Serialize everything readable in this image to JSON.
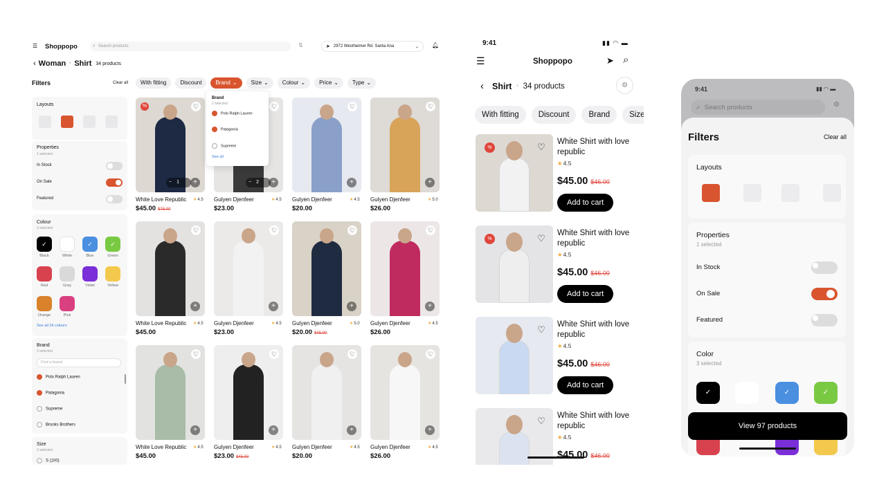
{
  "desktop": {
    "logo": "Shoppopo",
    "search_placeholder": "Search products",
    "address": "2972 Westheimer Rd. Santa Ana",
    "breadcrumb": {
      "level1": "Woman",
      "level2": "Shirt",
      "count": "34 products"
    },
    "filters_title": "Filters",
    "clear_all": "Clear all",
    "chips": [
      "With fitting",
      "Discount",
      "Brand",
      "Size",
      "Colour",
      "Price",
      "Type"
    ],
    "brand_dropdown": {
      "title": "Brand",
      "subtitle": "2 selected",
      "options": [
        "Polo Ralph Lauren",
        "Patagonia",
        "Supreme"
      ],
      "see_all": "See all"
    },
    "layouts": {
      "title": "Layouts"
    },
    "properties": {
      "title": "Properties",
      "subtitle": "1 selected",
      "items": [
        "In Stock",
        "On Sale",
        "Featured"
      ]
    },
    "colour": {
      "title": "Colour",
      "subtitle": "3 selected",
      "swatches": [
        {
          "name": "Black",
          "hex": "#000000",
          "checked": true
        },
        {
          "name": "White",
          "hex": "#ffffff",
          "checked": false
        },
        {
          "name": "Blue",
          "hex": "#4a8fe0",
          "checked": true
        },
        {
          "name": "Green",
          "hex": "#7ac943",
          "checked": true
        },
        {
          "name": "Red",
          "hex": "#d8424e",
          "checked": false
        },
        {
          "name": "Gray",
          "hex": "#d9d9d9",
          "checked": false
        },
        {
          "name": "Violet",
          "hex": "#7a2fd8",
          "checked": false
        },
        {
          "name": "Yellow",
          "hex": "#f2c94c",
          "checked": false
        },
        {
          "name": "Orange",
          "hex": "#d9822b",
          "checked": false
        },
        {
          "name": "Pink",
          "hex": "#d9407f",
          "checked": false
        }
      ],
      "see_all": "See all 24 colours"
    },
    "brand": {
      "title": "Brand",
      "subtitle": "2 selected",
      "placeholder": "Find a brand",
      "options": [
        "Polo Ralph Lauren",
        "Patagonia",
        "Supreme",
        "Brooks Brothers"
      ]
    },
    "size": {
      "title": "Size",
      "subtitle": "2 selected",
      "first_option": "S (100)"
    },
    "products": [
      {
        "name": "White Love Republic",
        "rating": "4.5",
        "price": "$45.00",
        "old": "$75.00"
      },
      {
        "name": "Gulyen Djenfeer",
        "rating": "4.5",
        "price": "$23.00",
        "old": ""
      },
      {
        "name": "Gulyen Djenfeer",
        "rating": "4.5",
        "price": "$20.00",
        "old": ""
      },
      {
        "name": "Gulyen Djenfeer",
        "rating": "5.0",
        "price": "$26.00",
        "old": ""
      },
      {
        "name": "White Love Republic",
        "rating": "4.5",
        "price": "$45.00",
        "old": ""
      },
      {
        "name": "Gulyen Djenfeer",
        "rating": "4.5",
        "price": "$23.00",
        "old": ""
      },
      {
        "name": "Gulyen Djenfeer",
        "rating": "5.0",
        "price": "$20.00",
        "old": "$45.00"
      },
      {
        "name": "Gulyen Djenfeer",
        "rating": "4.5",
        "price": "$26.00",
        "old": ""
      },
      {
        "name": "White Love Republic",
        "rating": "4.5",
        "price": "$45.00",
        "old": ""
      },
      {
        "name": "Gulyen Djenfeer",
        "rating": "4.5",
        "price": "$23.00",
        "old": "$45.00"
      },
      {
        "name": "Gulyen Djenfeer",
        "rating": "4.5",
        "price": "$20.00",
        "old": ""
      },
      {
        "name": "Gulyen Djenfeer",
        "rating": "4.5",
        "price": "$26.00",
        "old": ""
      }
    ],
    "stepper_a": "1",
    "stepper_b": "2"
  },
  "mobile": {
    "time": "9:41",
    "logo": "Shoppopo",
    "category": "Shirt",
    "count": "34 products",
    "chips": [
      "With fitting",
      "Discount",
      "Brand",
      "Size"
    ],
    "products": [
      {
        "name": "White Shirt with love republic",
        "rating": "4.5",
        "price": "$45.00",
        "old": "$46.00"
      },
      {
        "name": "White Shirt with love republic",
        "rating": "4.5",
        "price": "$45.00",
        "old": "$46.00"
      },
      {
        "name": "White Shirt with love republic",
        "rating": "4.5",
        "price": "$45.00",
        "old": "$46.00"
      },
      {
        "name": "White Shirt with love republic",
        "rating": "4.5",
        "price": "$45.00",
        "old": "$46.00"
      }
    ],
    "add_to_cart": "Add to cart"
  },
  "sheet": {
    "time": "9:41",
    "search_placeholder": "Search products",
    "title": "Filters",
    "clear_all": "Clear all",
    "layouts_title": "Layouts",
    "properties_title": "Properties",
    "properties_subtitle": "1 selected",
    "properties": [
      "In Stock",
      "On Sale",
      "Featured"
    ],
    "color_title": "Color",
    "color_subtitle": "3 selected",
    "view_button": "View 97 products"
  }
}
